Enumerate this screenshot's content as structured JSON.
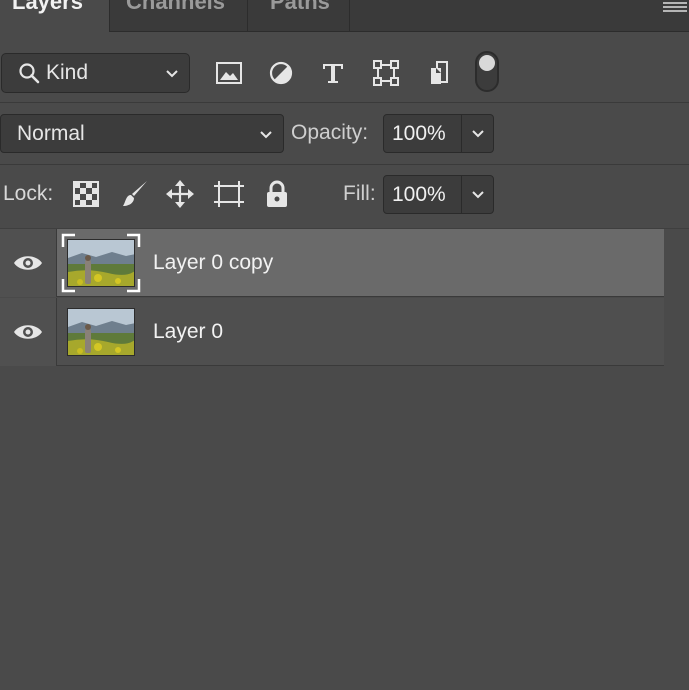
{
  "tabs": [
    {
      "label": "Layers",
      "active": true
    },
    {
      "label": "Channels",
      "active": false
    },
    {
      "label": "Paths",
      "active": false
    }
  ],
  "filter": {
    "kind_label": "Kind",
    "icons": [
      "image-filter-icon",
      "adjustment-filter-icon",
      "type-filter-icon",
      "shape-filter-icon",
      "smart-object-filter-icon"
    ]
  },
  "blend": {
    "mode": "Normal",
    "opacity_label": "Opacity:",
    "opacity_value": "100%"
  },
  "lock": {
    "label": "Lock:",
    "fill_label": "Fill:",
    "fill_value": "100%",
    "icons": [
      "lock-transparent-pixels-icon",
      "lock-image-pixels-icon",
      "lock-position-icon",
      "lock-artboard-icon",
      "lock-all-icon"
    ]
  },
  "layers": [
    {
      "name": "Layer 0 copy",
      "selected": true,
      "visible": true
    },
    {
      "name": "Layer 0",
      "selected": false,
      "visible": true
    }
  ],
  "colors": {
    "panel_bg": "#4a4a4a",
    "selected_row": "#6a6a6a",
    "text": "#e6e6e6"
  }
}
